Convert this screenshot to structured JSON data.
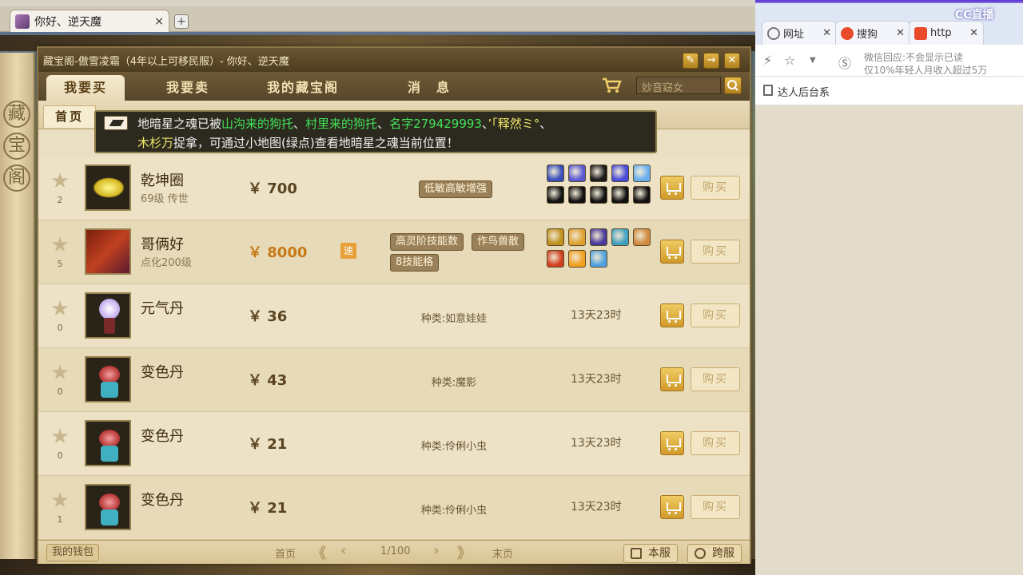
{
  "host_tab": {
    "title": "你好、逆天魔",
    "close": "×",
    "new": "+"
  },
  "side_scroll": [
    "藏",
    "宝",
    "阁"
  ],
  "window": {
    "title": "藏宝阁-傲雪凌霜（4年以上可移民服）- 你好、逆天魔",
    "nav": [
      "我要买",
      "我要卖",
      "我的藏宝阁",
      "消　息"
    ],
    "search_placeholder": "妙音窈女",
    "home_tab": "首页"
  },
  "notice": {
    "p1": "地暗星之魂已被",
    "n1": "山沟来的狗托",
    "s1": "、",
    "n2": "村里来的狗托",
    "s2": "、",
    "n3": "名字279429993",
    "s3": "、",
    "n4": "’「释然ミ°",
    "s4": "、",
    "n5": "木杉万",
    "p2": "捉拿，可通过小地图(绿点)查看地暗星之魂当前位置！"
  },
  "items": [
    {
      "name": "乾坤圈",
      "sub": "69级 传世",
      "price": "￥ 700",
      "favs": "2",
      "tags": [
        "低敏高敏增强"
      ],
      "kind": "",
      "time": "",
      "skill_colors": [
        "#3a4fb8",
        "#5a5ad0",
        "#1a1a1a",
        "#4a4ad8",
        "#6ab0f0",
        "#111",
        "#111",
        "#111",
        "#111",
        "#111"
      ]
    },
    {
      "name": "哥俩好",
      "sub": "点化200级",
      "price": "￥ 8000",
      "favs": "5",
      "quick": "速",
      "tags": [
        "高灵阶技能数",
        "作鸟兽散",
        "8技能格"
      ],
      "kind": "",
      "time": "",
      "skill_colors": [
        "#c09020",
        "#e0a030",
        "#4a3a9a",
        "#40a0c0",
        "#d08a40",
        "#d04020",
        "#f0a020",
        "#50a0e0"
      ]
    },
    {
      "name": "元气丹",
      "sub": "",
      "price": "￥ 36",
      "favs": "0",
      "tags": [],
      "kind": "种类:如意娃娃",
      "time": "13天23时",
      "skill_colors": []
    },
    {
      "name": "变色丹",
      "sub": "",
      "price": "￥ 43",
      "favs": "0",
      "tags": [],
      "kind": "种类:魔影",
      "time": "13天23时",
      "skill_colors": []
    },
    {
      "name": "变色丹",
      "sub": "",
      "price": "￥ 21",
      "favs": "0",
      "tags": [],
      "kind": "种类:伶俐小虫",
      "time": "13天23时",
      "skill_colors": []
    },
    {
      "name": "变色丹",
      "sub": "",
      "price": "￥ 21",
      "favs": "1",
      "tags": [],
      "kind": "种类:伶俐小虫",
      "time": "13天23时",
      "skill_colors": []
    }
  ],
  "buy_label": "购买",
  "footer": {
    "wallet": "我的钱包",
    "first": "首页",
    "page": "1/100",
    "last": "末页",
    "local": "本服",
    "cross": "跨服"
  },
  "right_browser": {
    "tabs": [
      "网址",
      "搜狗",
      "http"
    ],
    "cc_logo": "CC直播",
    "url_line1": "微信回应:不会显示已读",
    "url_line2": "仅10%年轻人月收入超过5万",
    "bookmark": "达人后台系"
  }
}
